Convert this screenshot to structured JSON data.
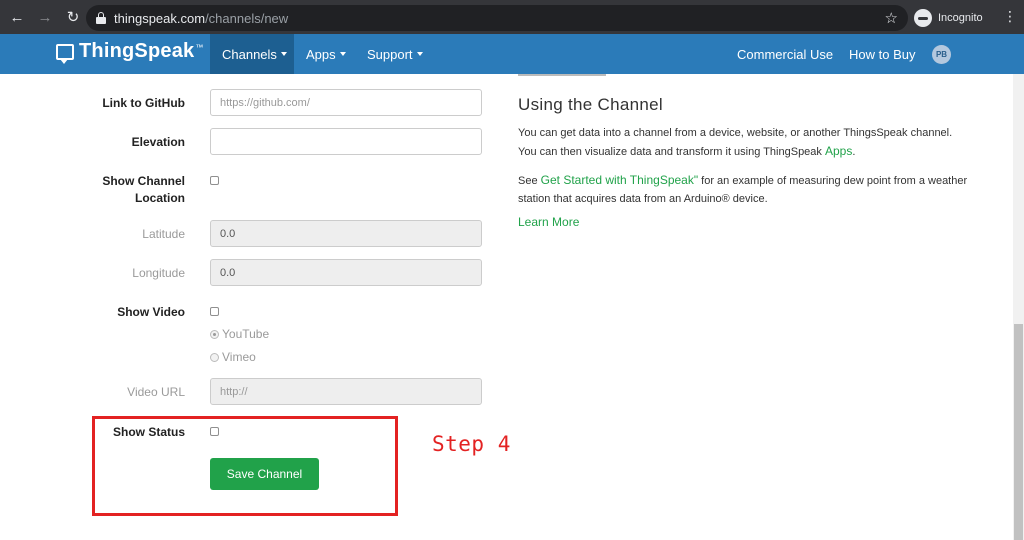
{
  "browser": {
    "url_domain": "thingspeak.com",
    "url_path": "/channels/new",
    "profile_label": "Incognito"
  },
  "nav": {
    "brand": "ThingSpeak",
    "brand_tm": "™",
    "menu": [
      {
        "label": "Channels",
        "dropdown": true,
        "active": true
      },
      {
        "label": "Apps",
        "dropdown": true,
        "active": false
      },
      {
        "label": "Support",
        "dropdown": true,
        "active": false
      }
    ],
    "right_links": [
      "Commercial Use",
      "How to Buy"
    ],
    "avatar_initials": "PB"
  },
  "form": {
    "link_to_github": {
      "label": "Link to GitHub",
      "placeholder": "https://github.com/",
      "value": ""
    },
    "elevation": {
      "label": "Elevation",
      "value": ""
    },
    "show_channel_location": {
      "label_line1": "Show Channel",
      "label_line2": "Location",
      "checked": false
    },
    "latitude": {
      "label": "Latitude",
      "value": "0.0"
    },
    "longitude": {
      "label": "Longitude",
      "value": "0.0"
    },
    "show_video": {
      "label": "Show Video",
      "checked": false
    },
    "video_options": [
      {
        "label": "YouTube",
        "checked": true
      },
      {
        "label": "Vimeo",
        "checked": false
      }
    ],
    "video_url": {
      "label": "Video URL",
      "placeholder": "http://"
    },
    "show_status": {
      "label": "Show Status",
      "checked": false
    },
    "save_button": "Save Channel"
  },
  "annotation": {
    "step_label": "Step 4",
    "color": "#e32222"
  },
  "sidebar": {
    "title": "Using the Channel",
    "para1_text": "You can get data into a channel from a device, website, or another ThingsSpeak channel. You can then visualize data and transform it using ThingSpeak ",
    "para1_link": "Apps",
    "para1_end": ".",
    "para2_start": "See ",
    "para2_link": "Get Started with ThingSpeak\"",
    "para2_text": " for an example of measuring dew point from a weather station that acquires data from an Arduino® device.",
    "learn_more": "Learn More"
  },
  "colors": {
    "nav_bg": "#2b7bb9",
    "nav_active": "#1d5f91",
    "button_green": "#21a24a",
    "link_green": "#21a24a"
  }
}
